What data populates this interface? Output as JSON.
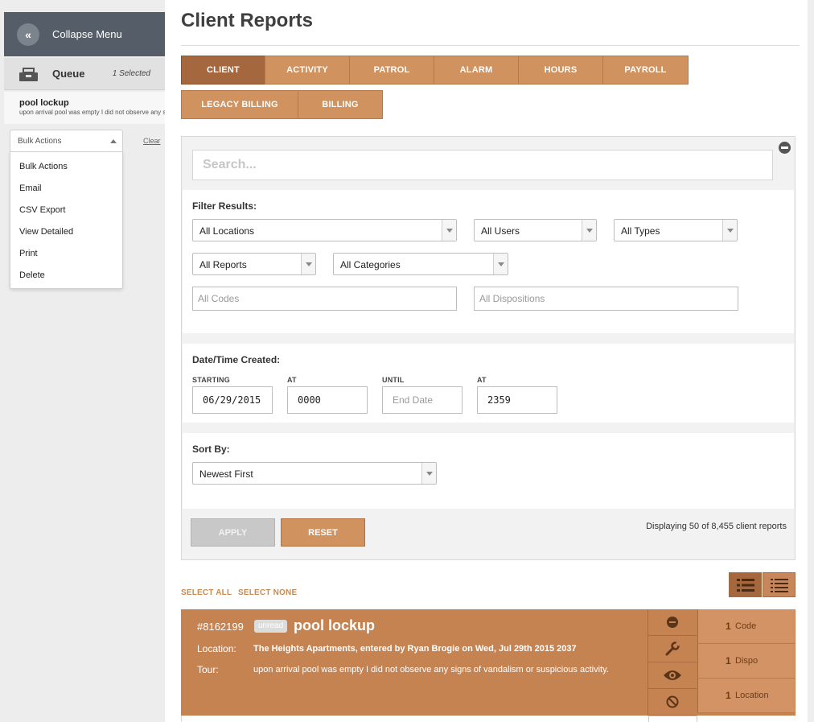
{
  "sidebar": {
    "collapse_label": "Collapse Menu",
    "collapse_glyph": "«",
    "queue_label": "Queue",
    "queue_count": "1 Selected",
    "queue_item": {
      "title": "pool lockup",
      "text": "upon arrival pool was empty I did not observe any signs of vandalism or suspicious activity."
    },
    "bulk_actions_label": "Bulk Actions",
    "clear_label": "Clear",
    "bulk_menu": [
      "Bulk Actions",
      "Email",
      "CSV Export",
      "View Detailed",
      "Print",
      "Delete"
    ]
  },
  "page": {
    "title": "Client Reports"
  },
  "tabs": [
    "CLIENT",
    "ACTIVITY",
    "PATROL",
    "ALARM",
    "HOURS",
    "PAYROLL",
    "LEGACY BILLING",
    "BILLING"
  ],
  "active_tab": "CLIENT",
  "search": {
    "placeholder": "Search..."
  },
  "filters": {
    "label": "Filter Results:",
    "locations": "All Locations",
    "users": "All Users",
    "types": "All Types",
    "reports": "All Reports",
    "categories": "All Categories",
    "codes_placeholder": "All Codes",
    "dispositions_placeholder": "All Dispositions"
  },
  "datetime": {
    "label": "Date/Time Created:",
    "starting_label": "STARTING",
    "starting_value": "06/29/2015",
    "at_label": "AT",
    "at_value": "0000",
    "until_label": "UNTIL",
    "until_placeholder": "End Date",
    "at2_label": "AT",
    "at2_value": "2359"
  },
  "sort": {
    "label": "Sort By:",
    "value": "Newest First"
  },
  "actions": {
    "apply": "APPLY",
    "reset": "RESET",
    "display_count": "Displaying 50 of 8,455 client reports"
  },
  "selection": {
    "select_all": "SELECT ALL",
    "select_none": "SELECT NONE"
  },
  "report": {
    "id": "#8162199",
    "badge": "unread",
    "title": "pool lockup",
    "location_label": "Location:",
    "location_value": "The Heights Apartments, entered by Ryan Brogie on Wed, Jul 29th 2015 2037",
    "tour_label": "Tour:",
    "tour_value": "upon arrival pool was empty I did not observe any signs of vandalism or suspicious activity.",
    "code_count": "1",
    "code_label": "Code",
    "dispo_count": "1",
    "dispo_label": "Dispo",
    "location_count": "1",
    "location_count_label": "Location"
  },
  "colors": {
    "accent": "#d0925f",
    "accent_dark": "#a5673d",
    "card": "#c68352",
    "sidebar_header": "#545d68"
  }
}
